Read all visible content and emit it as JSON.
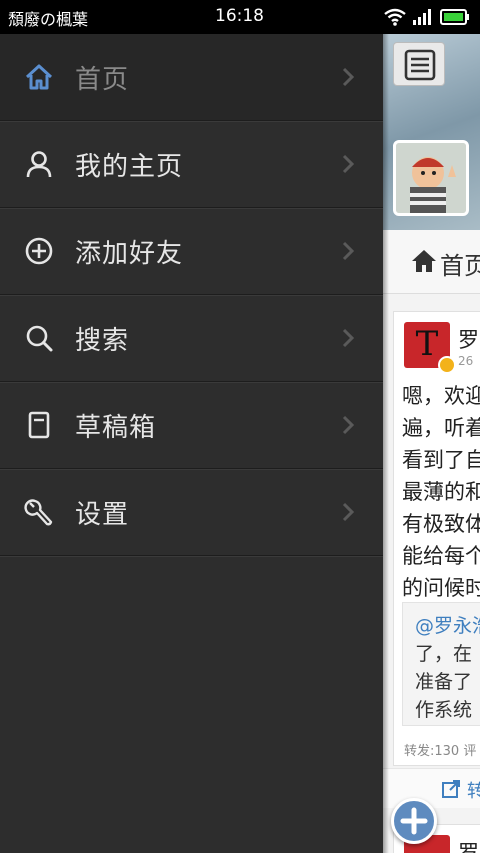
{
  "status_bar": {
    "carrier": "頹廢の楓葉",
    "time": "16:18",
    "icons": [
      "wifi-icon",
      "signal-icon",
      "battery-icon"
    ]
  },
  "drawer": {
    "items": [
      {
        "label": "首页",
        "icon": "home-icon",
        "active": true
      },
      {
        "label": "我的主页",
        "icon": "user-icon"
      },
      {
        "label": "添加好友",
        "icon": "add-circle-icon"
      },
      {
        "label": "搜索",
        "icon": "search-icon"
      },
      {
        "label": "草稿箱",
        "icon": "drafts-icon"
      },
      {
        "label": "设置",
        "icon": "wrench-icon"
      }
    ]
  },
  "content": {
    "tab_label": "首页",
    "post": {
      "author": "罗",
      "date": "26",
      "lines": [
        "嗯，欢迎",
        "遍，听着",
        "看到了自",
        "最薄的和",
        "有极致体",
        "能给每个",
        "的问候时"
      ],
      "quote_lines": [
        "@罗永浩",
        "了，在",
        "准备了",
        "作系统"
      ],
      "repost_count": "转发:130  评",
      "repost_button": "转"
    },
    "post2_author": "罗"
  },
  "colors": {
    "drawer_bg": "#2d2d2d",
    "accent_blue": "#3f7fbf",
    "active_icon": "#5b8fd0",
    "logo_red": "#c8262a"
  }
}
